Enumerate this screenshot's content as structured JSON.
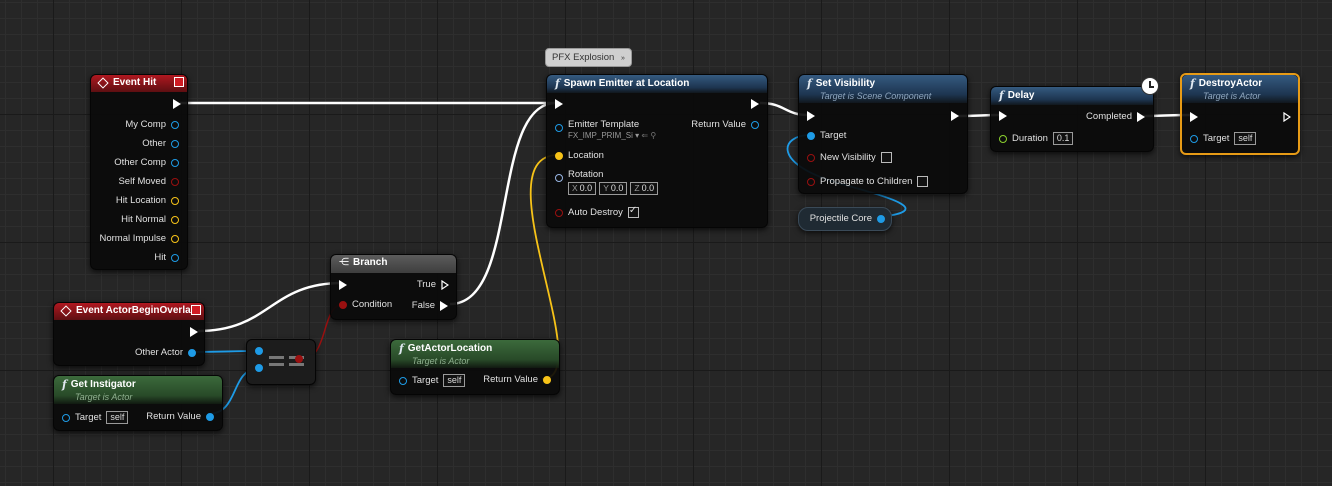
{
  "comment": {
    "text": "PFX Explosion"
  },
  "event_hit": {
    "title": "Event Hit",
    "pins": [
      "My Comp",
      "Other",
      "Other Comp",
      "Self Moved",
      "Hit Location",
      "Hit Normal",
      "Normal Impulse",
      "Hit"
    ]
  },
  "event_overlap": {
    "title": "Event ActorBeginOverlap",
    "other_actor": "Other Actor"
  },
  "get_instigator": {
    "title": "Get Instigator",
    "subtitle": "Target is Actor",
    "target": "Target",
    "self": "self",
    "return_value": "Return Value"
  },
  "branch": {
    "title": "Branch",
    "true": "True",
    "false": "False",
    "condition": "Condition"
  },
  "spawn": {
    "title": "Spawn Emitter at Location",
    "emitter_template": "Emitter Template",
    "template_value": "FX_IMP_PRIM_Si",
    "return_value": "Return Value",
    "location": "Location",
    "rotation": "Rotation",
    "rot_x_label": "X",
    "rot_x": "0.0",
    "rot_y_label": "Y",
    "rot_y": "0.0",
    "rot_z_label": "Z",
    "rot_z": "0.0",
    "auto_destroy": "Auto Destroy"
  },
  "get_actor_location": {
    "title": "GetActorLocation",
    "subtitle": "Target is Actor",
    "target": "Target",
    "self": "self",
    "return_value": "Return Value"
  },
  "set_visibility": {
    "title": "Set Visibility",
    "subtitle": "Target is Scene Component",
    "target": "Target",
    "new_visibility": "New Visibility",
    "propagate": "Propagate to Children"
  },
  "projectile_core": {
    "label": "Projectile Core"
  },
  "delay": {
    "title": "Delay",
    "completed": "Completed",
    "duration": "Duration",
    "duration_value": "0.1"
  },
  "destroy_actor": {
    "title": "DestroyActor",
    "subtitle": "Target is Actor",
    "target": "Target",
    "self": "self"
  },
  "colors": {
    "exec": "#ffffff",
    "object": "#1e9be6",
    "vector": "#f7c318",
    "struct": "#e6a026",
    "bool": "#9a1010",
    "float": "#8ad12e",
    "event": "#b01820",
    "function": "#355a80",
    "pure": "#3c6a3c"
  }
}
